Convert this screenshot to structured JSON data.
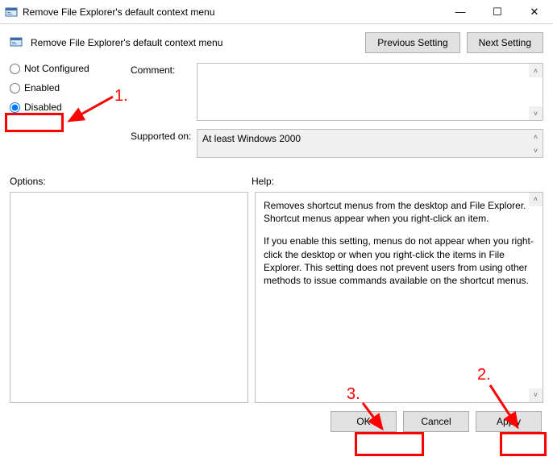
{
  "titlebar": {
    "title": "Remove File Explorer's default context menu"
  },
  "header": {
    "title": "Remove File Explorer's default context menu",
    "prev_btn": "Previous Setting",
    "next_btn": "Next Setting"
  },
  "radios": {
    "not_configured": "Not Configured",
    "enabled": "Enabled",
    "disabled": "Disabled"
  },
  "fields": {
    "comment_label": "Comment:",
    "supported_label": "Supported on:",
    "supported_value": "At least Windows 2000"
  },
  "lower": {
    "options_label": "Options:",
    "help_label": "Help:",
    "help_p1": "Removes shortcut menus from the desktop and File Explorer. Shortcut menus appear when you right-click an item.",
    "help_p2": "If you enable this setting, menus do not appear when you right-click the desktop or when you right-click the items in File Explorer. This setting does not prevent users from using other methods to issue commands available on the shortcut menus."
  },
  "footer": {
    "ok": "OK",
    "cancel": "Cancel",
    "apply": "Apply"
  },
  "annotations": {
    "n1": "1.",
    "n2": "2.",
    "n3": "3."
  }
}
